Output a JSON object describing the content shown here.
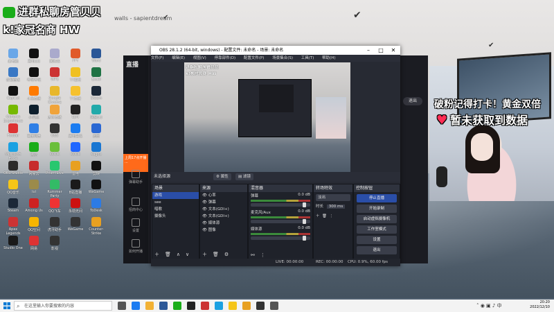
{
  "overlay": {
    "line1": "进群私聊房管贝贝",
    "line2": "k!家冠名商 HW",
    "watermark": "walls - sapientdream"
  },
  "desktop_icons": [
    {
      "label": "此电脑",
      "color": "#6aa7e8"
    },
    {
      "label": "腾讯QQ",
      "color": "#111"
    },
    {
      "label": "回收站",
      "color": "#aac"
    },
    {
      "label": "PPT",
      "color": "#e05a2a"
    },
    {
      "label": "Word",
      "color": "#2b5797"
    },
    {
      "label": "控制面板",
      "color": "#3a78c4"
    },
    {
      "label": "哔哩哔哩",
      "color": "#111"
    },
    {
      "label": "WPS",
      "color": "#c33"
    },
    {
      "label": "YY语音",
      "color": "#f0c020"
    },
    {
      "label": "Excel",
      "color": "#1f7244"
    },
    {
      "label": "CapCut",
      "color": "#111"
    },
    {
      "label": "斗鱼直播",
      "color": "#ff7a00"
    },
    {
      "label": "Google Chrome",
      "color": "#e8b72b"
    },
    {
      "label": "YY直播",
      "color": "#f6c12d"
    },
    {
      "label": "Steam",
      "color": "#1b2838"
    },
    {
      "label": "GeForce Experience",
      "color": "#76b900"
    },
    {
      "label": "小黑盒",
      "color": "#0e1f2d"
    },
    {
      "label": "虎牙直播",
      "color": "#f0a33a"
    },
    {
      "label": "Epic",
      "color": "#222"
    },
    {
      "label": "网易UU",
      "color": "#2aa"
    },
    {
      "label": "Foobar",
      "color": "#d33"
    },
    {
      "label": "百度网盘",
      "color": "#2f7fe6"
    },
    {
      "label": "OBS",
      "color": "#333"
    },
    {
      "label": "腾讯会议",
      "color": "#1b7cf1"
    },
    {
      "label": "迅雷",
      "color": "#2a68d3"
    },
    {
      "label": "Microsoft Edge",
      "color": "#1ba1e2"
    },
    {
      "label": "微信",
      "color": "#1aad19"
    },
    {
      "label": "KOOK",
      "color": "#6abf3a"
    },
    {
      "label": "KOOK",
      "color": "#1f66ff"
    },
    {
      "label": "Kugou",
      "color": "#1976d2"
    },
    {
      "label": "OBS Studio",
      "color": "#2b2b2b"
    },
    {
      "label": "网易云",
      "color": "#c72c2c"
    },
    {
      "label": "Prism Live",
      "color": "#28c76f"
    },
    {
      "label": "雷电",
      "color": "#e8a020"
    },
    {
      "label": "剪映",
      "color": "#111"
    },
    {
      "label": "QQ音乐",
      "color": "#f5c518"
    },
    {
      "label": "lol",
      "color": "#9b8b4b"
    },
    {
      "label": "Rummer Party",
      "color": "#3b6"
    },
    {
      "label": "B站直播",
      "color": "#1a1a1a"
    },
    {
      "label": "WeGame",
      "color": "#111"
    },
    {
      "label": "Steam",
      "color": "#1b2838"
    },
    {
      "label": "Among Us",
      "color": "#c22"
    },
    {
      "label": "QQ飞车",
      "color": "#e33"
    },
    {
      "label": "永劫无间",
      "color": "#c11"
    },
    {
      "label": "ToDesk",
      "color": "#2c7be5"
    },
    {
      "label": "Apex Legends",
      "color": "#c33"
    },
    {
      "label": "QQ空间",
      "color": "#f7b500"
    },
    {
      "label": "虎牙助手",
      "color": "#333"
    },
    {
      "label": "WeGame",
      "color": "#333"
    },
    {
      "label": "Counter-Strike",
      "color": "#e8a020"
    },
    {
      "label": "Studio One",
      "color": "#1a1a1a"
    },
    {
      "label": "网易",
      "color": "#d33"
    },
    {
      "label": "影视",
      "color": "#333"
    }
  ],
  "live_app": {
    "logo": "直播",
    "side": [
      "弹幕助手",
      "招商中心",
      "设置",
      "如何开播"
    ],
    "promo": "上周17点开播 ...",
    "btn_out": "退出"
  },
  "right_overlay": {
    "line1": "破粉记得打卡！黄金双倍",
    "line2": "暂未获取到数据"
  },
  "obs": {
    "title": "OBS 28.1.2 (64-bit, windows) - 配置文件: 未命名 - 场景: 未命名",
    "menu": [
      "文件(F)",
      "编辑(E)",
      "视图(V)",
      "停靠部件(D)",
      "配置文件(P)",
      "场景集合(S)",
      "工具(T)",
      "帮助(H)"
    ],
    "preview_overlay1": "进群私聊房管贝贝",
    "preview_overlay2": "k!家冠名商 HW",
    "source_bar": {
      "label": "未选择源",
      "props": "属性",
      "filters": "滤镜"
    },
    "scenes": {
      "title": "场景",
      "items": [
        "游戏",
        "see",
        "唱歌",
        "摄像头"
      ]
    },
    "sources": {
      "title": "来源",
      "items": [
        "心率",
        "弹幕",
        "文本(GDI+)",
        "文本(GDI+)",
        "媒体源",
        "图像"
      ]
    },
    "mixer": {
      "title": "混音器",
      "channels": [
        {
          "name": "弹幕",
          "db": "0.0 dB",
          "level": 0.6
        },
        {
          "name": "麦克风/Aux",
          "db": "0.0 dB",
          "level": 0.7
        },
        {
          "name": "媒体源",
          "db": "0.0 dB",
          "level": 0.55
        }
      ]
    },
    "transitions": {
      "title": "转场特效",
      "type": "淡出",
      "duration_label": "时长",
      "duration": "300 ms"
    },
    "controls": {
      "title": "控制按钮",
      "buttons": [
        "停止直播",
        "开始录制",
        "启动虚拟摄像机",
        "工作室模式",
        "设置",
        "退出"
      ]
    },
    "status": {
      "live": "LIVE: 00:00:00",
      "rec": "REC: 00:00:00",
      "cpu": "CPU: 0.9%, 60.00 fps"
    }
  },
  "taskbar": {
    "search_placeholder": "在这里输入你要搜索的内容",
    "time": "20:20",
    "date": "2022/12/10"
  }
}
